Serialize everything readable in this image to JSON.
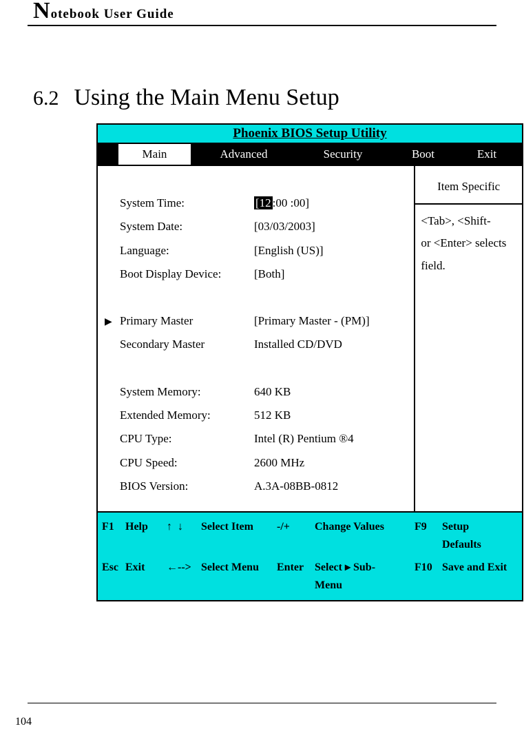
{
  "header": {
    "title_cap": "N",
    "title_rest": "otebook User Guide"
  },
  "section": {
    "number": "6.2",
    "title": "Using the Main Menu Setup"
  },
  "bios": {
    "window_title": "Phoenix BIOS Setup Utility",
    "tabs": {
      "main": "Main",
      "advanced": "Advanced",
      "security": "Security",
      "boot": "Boot",
      "exit": "Exit"
    },
    "side": {
      "header": "Item Specific",
      "body1": "<Tab>, <Shift-",
      "body2": "or <Enter> selects",
      "body3": "field."
    },
    "fields": {
      "system_time_label": "System Time:",
      "system_time_value_hl": "[12",
      "system_time_value_rest": ":00 :00]",
      "system_date_label": "System Date:",
      "system_date_value": "[03/03/2003]",
      "language_label": "Language:",
      "language_value": "[English (US)]",
      "boot_display_label": "Boot Display Device:",
      "boot_display_value": "[Both]",
      "primary_master_label": "Primary Master",
      "primary_master_value": "[Primary Master - (PM)]",
      "secondary_master_label": "Secondary Master",
      "secondary_master_value": "Installed CD/DVD",
      "system_memory_label": "System Memory:",
      "system_memory_value": "640 KB",
      "extended_memory_label": "Extended Memory:",
      "extended_memory_value": "512 KB",
      "cpu_type_label": "CPU Type:",
      "cpu_type_value": "Intel (R) Pentium ®4",
      "cpu_speed_label": "CPU Speed:",
      "cpu_speed_value": "2600 MHz",
      "bios_version_label": "BIOS Version:",
      "bios_version_value": "A.3A-08BB-0812"
    },
    "footer": {
      "f1": "F1",
      "help": "Help",
      "arrows_ud": "↑  ↓",
      "select_item": "Select Item",
      "minus_plus": "-/+",
      "change_values": "Change Values",
      "f9": "F9",
      "setup_defaults": "Setup\nDefaults",
      "esc": "Esc",
      "exit": "Exit",
      "arrows_lr": "←-->",
      "select_menu": "Select Menu",
      "enter": "Enter",
      "select_sub": "Select ▸ Sub-\nMenu",
      "f10": "F10",
      "save_exit": "Save and Exit"
    }
  },
  "page_number": "104"
}
